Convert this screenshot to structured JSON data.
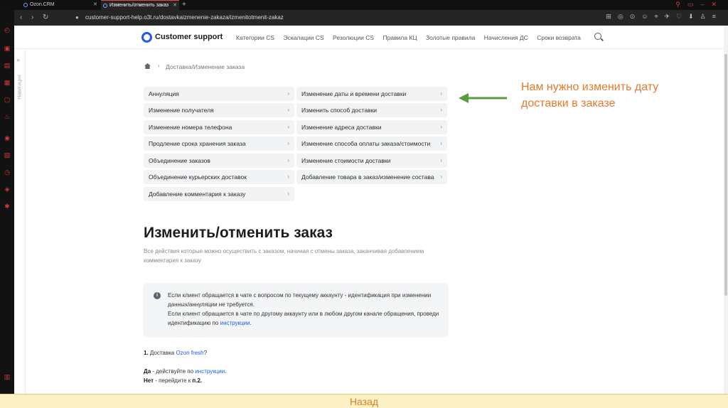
{
  "browser": {
    "tabs": [
      {
        "label": "Ozon.CRM"
      },
      {
        "label": "Изменить/отменить заказ"
      }
    ],
    "url": "customer-support-help.o3t.ru/dostavkaizmenenie-zakaza/izmenitotmenit-zakaz"
  },
  "header": {
    "logo": "Customer support",
    "menu": [
      "Категории CS",
      "Эскалации CS",
      "Резолюции CS",
      "Правила КЦ",
      "Золотые правила",
      "Начисления ДС",
      "Сроки возврата"
    ]
  },
  "navstrip": {
    "label": "Навигация"
  },
  "breadcrumb": {
    "path": "Доставка/Изменение заказа"
  },
  "cards": {
    "left": [
      "Аннуляция",
      "Изменение получателя",
      "Изменение номера телефона",
      "Продление срока хранения заказа",
      "Объединение заказов",
      "Объединение курьерских доставок",
      "Добавление комментария к заказу"
    ],
    "right": [
      "Изменение даты и времени доставки",
      "Изменить способ доставки",
      "Изменение адреса доставки",
      "Изменение способа оплаты заказа/стоимости",
      "Изменение стоимости доставки",
      "Добавление товара в заказ/изменение состава"
    ]
  },
  "annotation": {
    "text": "Нам нужно изменить дату доставки в заказе",
    "color": "#e8792d",
    "arrow_color": "#5a9b3c"
  },
  "article": {
    "title": "Изменить/отменить заказ",
    "description": "Все действия которые можно осуществить с заказом, начиная с отмены заказа, заканчивая добавлением комментария к заказу",
    "info": {
      "line1": "Если клиент обращается в чате с вопросом по текущему аккаунту - идентификация при изменении данных/аннуляции не требуется.",
      "line2": "Если клиент обращается в чате по другому аккаунту или в любом другом канале обращения, проведи идентификацию по ",
      "link": "инструкции",
      "tail": "."
    },
    "step1": {
      "num": "1.",
      "text": " Доставка ",
      "link": "Ozon fresh",
      "tail": "?"
    },
    "yes": {
      "label": "Да",
      "text": " - действуйте по ",
      "link": "инструкции",
      "tail": "."
    },
    "no": {
      "label": "Нет",
      "text": " - перейдите к ",
      "ref": "п.2",
      "tail": "."
    }
  },
  "footer": {
    "back": "Назад"
  }
}
